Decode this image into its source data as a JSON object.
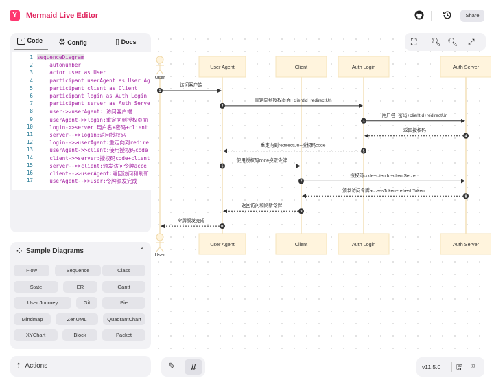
{
  "header": {
    "title": "Mermaid Live Editor",
    "logo": "Y",
    "share_label": "Share",
    "icons": [
      "github-icon",
      "history-icon"
    ]
  },
  "editor": {
    "tabs": [
      {
        "label": "Code"
      },
      {
        "label": "Config"
      },
      {
        "label": "Docs"
      }
    ],
    "lines": [
      "sequenceDiagram",
      "    autonumber",
      "    actor user as User",
      "    participant userAgent as User Ag",
      "    participant client as Client",
      "    participant login as Auth Login",
      "    participant server as Auth Serve",
      "    user->>userAgent: 访问客户端",
      "    userAgent->>login:重定向到授权页面",
      "    login->>server:用户名+密码+client",
      "    server-->>login:返回授权码",
      "    login-->>userAgent:重定向到redire",
      "    userAgent->>client:使用授权码code",
      "    client->>server:授权码code+client",
      "    server-->>client:颁发访问令牌acce",
      "    client-->>userAgent:返回访问和刷新",
      "    userAgent-->>user:令牌颁发完成"
    ]
  },
  "samples": {
    "title": "Sample Diagrams",
    "items": [
      "Flow",
      "Sequence",
      "Class",
      "State",
      "ER",
      "Gantt",
      "User Journey",
      "Git",
      "Pie",
      "Mindmap",
      "ZenUML",
      "QuadrantChart",
      "XYChart",
      "Block",
      "Packet"
    ]
  },
  "actions": {
    "label": "Actions"
  },
  "version": "v11.5.0",
  "diagram": {
    "actors": [
      {
        "label": "User",
        "kind": "actor"
      },
      {
        "label": "User Agent"
      },
      {
        "label": "Client"
      },
      {
        "label": "Auth Login"
      },
      {
        "label": "Auth Server"
      }
    ],
    "messages": [
      {
        "n": "1",
        "from": 0,
        "to": 1,
        "text": "访问客户端",
        "dashed": false
      },
      {
        "n": "2",
        "from": 1,
        "to": 3,
        "text": "重定向到授权页面+clientId+redirectUrl",
        "dashed": false
      },
      {
        "n": "3",
        "from": 3,
        "to": 4,
        "text": "用户名+密码+clientId+redirectUrl",
        "dashed": false
      },
      {
        "n": "4",
        "from": 4,
        "to": 3,
        "text": "返回授权码",
        "dashed": true
      },
      {
        "n": "5",
        "from": 3,
        "to": 1,
        "text": "重定向到redirectUrl+授权码code",
        "dashed": true
      },
      {
        "n": "6",
        "from": 1,
        "to": 2,
        "text": "使用授权码code换取令牌",
        "dashed": false
      },
      {
        "n": "7",
        "from": 2,
        "to": 4,
        "text": "授权码code+clientId+clientSecret",
        "dashed": false
      },
      {
        "n": "8",
        "from": 4,
        "to": 2,
        "text": "颁发访问令牌accessToken+refreshToken",
        "dashed": true
      },
      {
        "n": "9",
        "from": 2,
        "to": 1,
        "text": "返回访问和刷新令牌",
        "dashed": true
      },
      {
        "n": "10",
        "from": 1,
        "to": 0,
        "text": "令牌颁发完成",
        "dashed": true
      }
    ]
  }
}
